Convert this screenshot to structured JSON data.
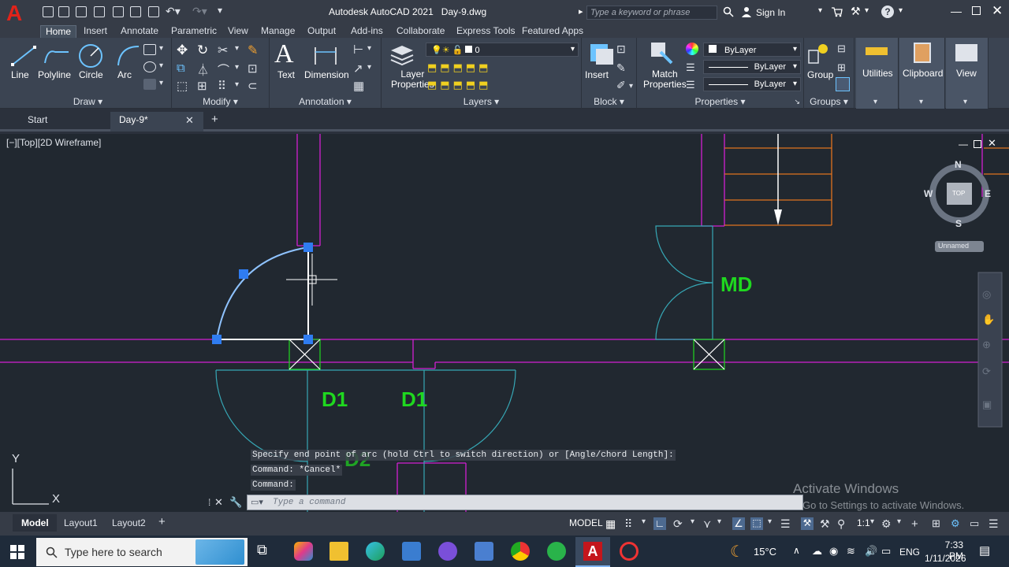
{
  "titlebar": {
    "app_title": "Autodesk AutoCAD 2021",
    "doc_title": "Day-9.dwg",
    "search_placeholder": "Type a keyword or phrase",
    "sign_in": "Sign In"
  },
  "ribbon_tabs": [
    "Home",
    "Insert",
    "Annotate",
    "Parametric",
    "View",
    "Manage",
    "Output",
    "Add-ins",
    "Collaborate",
    "Express Tools",
    "Featured Apps"
  ],
  "ribbon": {
    "draw": {
      "label": "Draw",
      "line": "Line",
      "polyline": "Polyline",
      "circle": "Circle",
      "arc": "Arc"
    },
    "modify": {
      "label": "Modify"
    },
    "annotation": {
      "label": "Annotation",
      "text": "Text",
      "dimension": "Dimension"
    },
    "layers": {
      "label": "Layers",
      "layer_properties_1": "Layer",
      "layer_properties_2": "Properties",
      "current_layer": "0"
    },
    "block": {
      "label": "Block",
      "insert": "Insert"
    },
    "properties": {
      "label": "Properties",
      "match_1": "Match",
      "match_2": "Properties",
      "color": "ByLayer",
      "linetype": "ByLayer",
      "lineweight": "ByLayer"
    },
    "groups": {
      "label": "Groups",
      "group": "Group"
    },
    "utilities": "Utilities",
    "clipboard": "Clipboard",
    "view": "View"
  },
  "doc_tabs": {
    "start": "Start",
    "active": "Day-9*",
    "add": "+"
  },
  "viewport": {
    "label": "[−][Top][2D Wireframe]",
    "viewcube": {
      "n": "N",
      "s": "S",
      "e": "E",
      "w": "W",
      "top": "TOP",
      "ucs": "Unnamed"
    },
    "texts": {
      "md": "MD",
      "d1a": "D1",
      "d1b": "D1",
      "d2": "D2"
    },
    "ucs_x": "X",
    "ucs_y": "Y"
  },
  "command": {
    "history": [
      "Specify end point of arc (hold Ctrl to switch direction) or [Angle/chord Length]:",
      "Command: *Cancel*",
      "Command:"
    ],
    "placeholder": "Type a command"
  },
  "watermark": {
    "line1": "Activate Windows",
    "line2": "Go to Settings to activate Windows."
  },
  "layout_tabs": [
    "Model",
    "Layout1",
    "Layout2"
  ],
  "status": {
    "model": "MODEL",
    "scale": "1:1"
  },
  "taskbar": {
    "search_placeholder": "Type here to search",
    "weather": "15°C",
    "lang": "ENG",
    "time": "7:33 PM",
    "date": "1/11/2026"
  },
  "colors": {
    "magenta": "#d21fd2",
    "cyan": "#36a7b5",
    "green_text": "#1fd81f",
    "orange": "#e0731f",
    "grip_blue": "#2f7cf0"
  }
}
